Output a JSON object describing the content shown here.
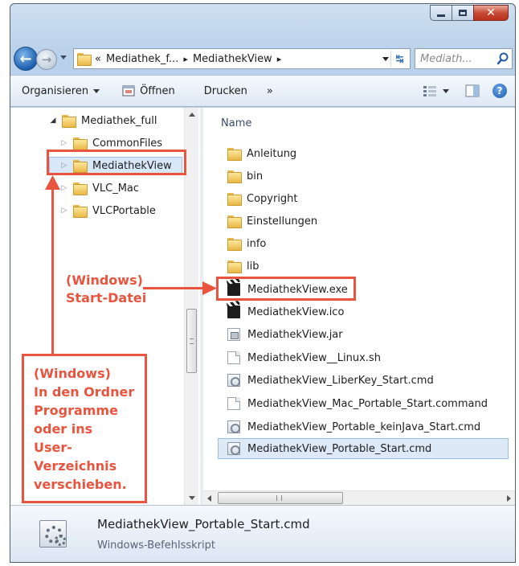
{
  "window": {
    "address": {
      "overflow": "«",
      "crumbs": [
        "Mediathek_f...",
        "MediathekView"
      ],
      "separator": "▸"
    },
    "search_placeholder": "Mediath..."
  },
  "toolbar": {
    "organize": "Organisieren",
    "open": "Öffnen",
    "print": "Drucken",
    "more": "»"
  },
  "tree": {
    "items": [
      {
        "label": "Mediathek_full",
        "expanded": true
      },
      {
        "label": "CommonFiles",
        "expanded": false
      },
      {
        "label": "MediathekView",
        "expanded": false,
        "selected": true
      },
      {
        "label": "VLC_Mac",
        "expanded": false
      },
      {
        "label": "VLCPortable",
        "expanded": false
      }
    ]
  },
  "files": {
    "column_header": "Name",
    "items": [
      {
        "name": "Anleitung",
        "icon": "folder-icon"
      },
      {
        "name": "bin",
        "icon": "folder-icon"
      },
      {
        "name": "Copyright",
        "icon": "folder-icon"
      },
      {
        "name": "Einstellungen",
        "icon": "folder-icon"
      },
      {
        "name": "info",
        "icon": "folder-icon"
      },
      {
        "name": "lib",
        "icon": "folder-icon"
      },
      {
        "name": "MediathekView.exe",
        "icon": "clapper-icon"
      },
      {
        "name": "MediathekView.ico",
        "icon": "clapper-icon"
      },
      {
        "name": "MediathekView.jar",
        "icon": "jar-icon"
      },
      {
        "name": "MediathekView__Linux.sh",
        "icon": "document-icon"
      },
      {
        "name": "MediathekView_LiberKey_Start.cmd",
        "icon": "cmd-icon"
      },
      {
        "name": "MediathekView_Mac_Portable_Start.command",
        "icon": "document-icon"
      },
      {
        "name": "MediathekView_Portable_keinJava_Start.cmd",
        "icon": "cmd-icon"
      },
      {
        "name": "MediathekView_Portable_Start.cmd",
        "icon": "cmd-icon",
        "selected": true
      }
    ]
  },
  "details": {
    "filename": "MediathekView_Portable_Start.cmd",
    "filetype": "Windows-Befehlsskript"
  },
  "annotations": {
    "start_file": [
      "(Windows)",
      "Start-Datei"
    ],
    "move_hint": [
      "(Windows)",
      "In den Ordner",
      "Programme",
      "oder ins User-",
      "Verzeichnis",
      "verschieben."
    ],
    "color": "#e8543e"
  }
}
